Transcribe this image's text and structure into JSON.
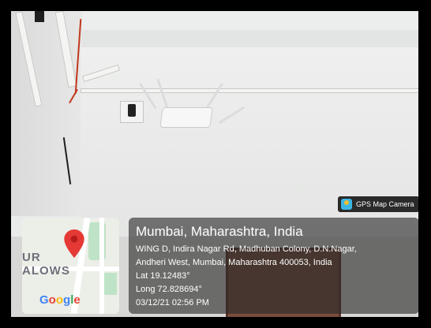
{
  "photo": {
    "subject": "wall-mounted white wifi router with antennas",
    "palette": {
      "wall": "#e9eaea",
      "cable": "#c2391f",
      "door": "#7a4c3a"
    }
  },
  "gps_badge": {
    "label": "GPS Map Camera",
    "icon": "gps-map-camera-app-icon"
  },
  "map": {
    "area_text_1": "UR",
    "area_text_2": "ALOWS",
    "logo": "Google",
    "pin_color": "#e53935",
    "icon": "location-pin-icon"
  },
  "info": {
    "city": "Mumbai, Maharashtra, India",
    "address_line1": "WING D, Indira Nagar Rd, Madhuban Colony, D.N.Nagar,",
    "address_line2": "Andheri West, Mumbai, Maharashtra 400053, India",
    "lat": "Lat 19.12483°",
    "long": "Long 72.828694°",
    "datetime": "03/12/21 02:56 PM"
  }
}
